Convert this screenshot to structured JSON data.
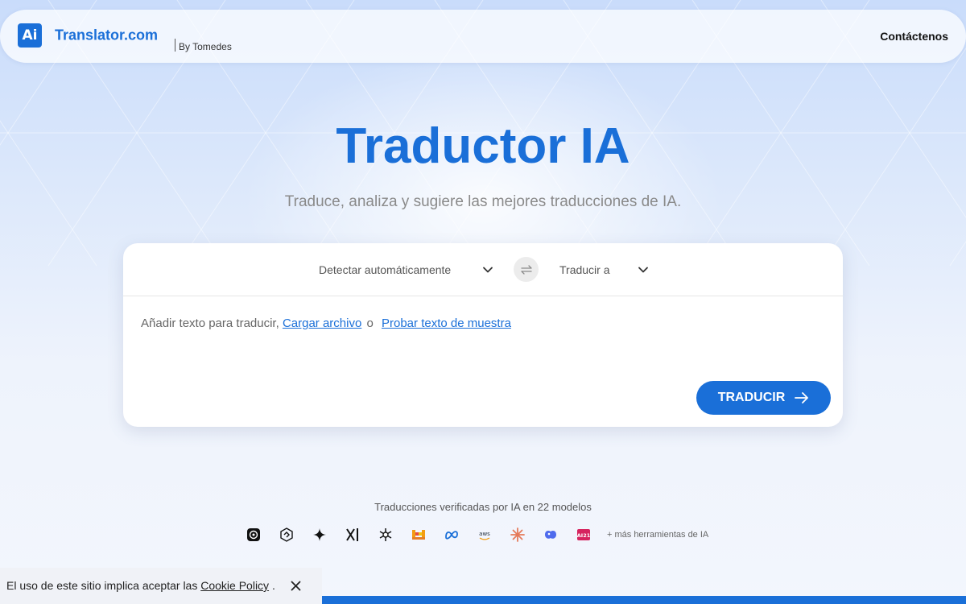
{
  "header": {
    "logo_text": "Ai",
    "brand": "Translator.com",
    "by": "By Tomedes",
    "contact": "Contáctenos"
  },
  "hero": {
    "title": "Traductor IA",
    "subtitle": "Traduce, analiza y sugiere las mejores traducciones de IA."
  },
  "translator": {
    "source_language": "Detectar automáticamente",
    "target_language": "Traducir a",
    "input_prompt": "Añadir texto para traducir,",
    "upload_link": "Cargar archivo",
    "or_text": "o",
    "sample_link": "Probar texto de muestra",
    "translate_button": "TRADUCIR"
  },
  "models": {
    "caption": "Traducciones verificadas por IA en 22 modelos",
    "icons": [
      "openai-icon",
      "deepseek-icon",
      "gemini-icon",
      "xai-icon",
      "perplexity-icon",
      "mistral-icon",
      "meta-icon",
      "aws-icon",
      "anthropic-icon",
      "qwen-icon",
      "ai21-icon"
    ],
    "aws_label": "aws",
    "ai21_label": "AI21",
    "more": "+ más herramientas de IA"
  },
  "cookie": {
    "text": "El uso de este sitio implica aceptar las",
    "link": "Cookie Policy",
    "suffix": "."
  },
  "colors": {
    "accent": "#1a6fd8",
    "mistral": "#f39c12",
    "anthropic": "#e57a5a",
    "ai21": "#d6245f"
  }
}
